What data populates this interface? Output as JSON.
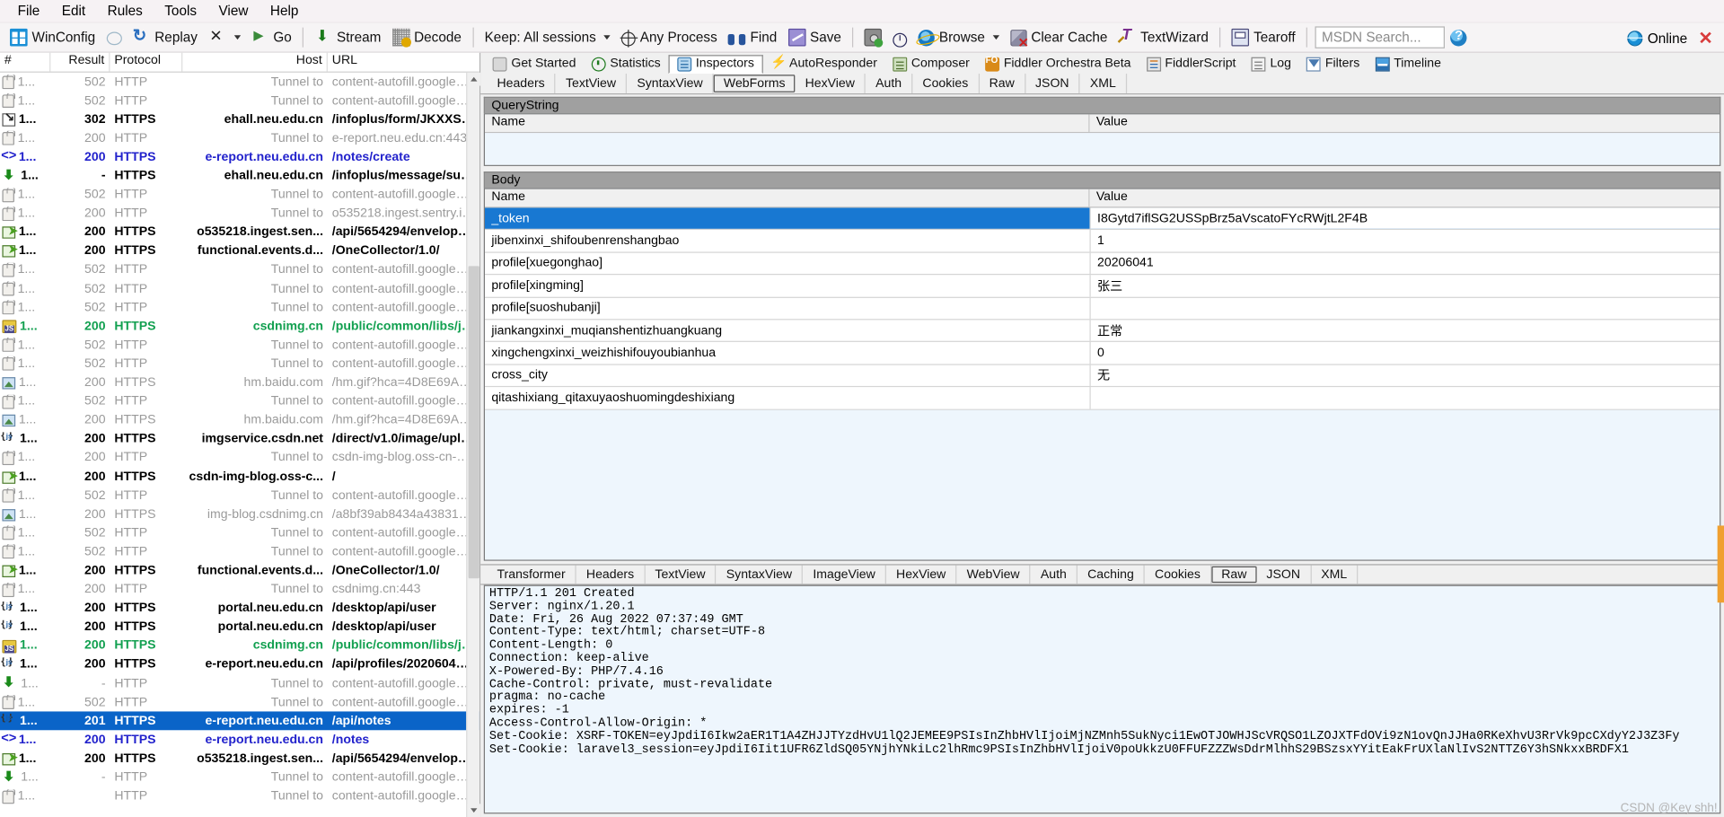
{
  "menu": {
    "items": [
      "File",
      "Edit",
      "Rules",
      "Tools",
      "View",
      "Help"
    ]
  },
  "toolbar": {
    "winconfig": "WinConfig",
    "replay": "Replay",
    "go": "Go",
    "stream": "Stream",
    "decode": "Decode",
    "keep": "Keep: All sessions",
    "any_process": "Any Process",
    "find": "Find",
    "save": "Save",
    "browse": "Browse",
    "clear_cache": "Clear Cache",
    "textwizard": "TextWizard",
    "tearoff": "Tearoff",
    "msdn_search": "MSDN Search...",
    "online": "Online",
    "close": "✕"
  },
  "sessions": {
    "columns": [
      "#",
      "Result",
      "Protocol",
      "Host",
      "URL"
    ],
    "rows": [
      {
        "icon": "lock-icon",
        "num": "1...",
        "result": "502",
        "protocol": "HTTP",
        "host": "Tunnel to",
        "url": "content-autofill.googleapi...",
        "style": "t-grey"
      },
      {
        "icon": "lock-icon",
        "num": "1...",
        "result": "502",
        "protocol": "HTTP",
        "host": "Tunnel to",
        "url": "content-autofill.googleapi...",
        "style": "t-grey"
      },
      {
        "icon": "redirect-icon",
        "num": "1...",
        "result": "302",
        "protocol": "HTTPS",
        "host": "ehall.neu.edu.cn",
        "url": "/infoplus/form/JKXXSB/start",
        "style": "t-black"
      },
      {
        "icon": "lock-icon",
        "num": "1...",
        "result": "200",
        "protocol": "HTTP",
        "host": "Tunnel to",
        "url": "e-report.neu.edu.cn:443",
        "style": "t-grey"
      },
      {
        "icon": "html-doc-icon",
        "num": "1...",
        "result": "200",
        "protocol": "HTTPS",
        "host": "e-report.neu.edu.cn",
        "url": "/notes/create",
        "style": "t-blue"
      },
      {
        "icon": "download-icon",
        "num": "1...",
        "result": "-",
        "protocol": "HTTPS",
        "host": "ehall.neu.edu.cn",
        "url": "/infoplus/message/sub?ui...",
        "style": "t-black"
      },
      {
        "icon": "lock-icon",
        "num": "1...",
        "result": "502",
        "protocol": "HTTP",
        "host": "Tunnel to",
        "url": "content-autofill.googleapi...",
        "style": "t-grey"
      },
      {
        "icon": "lock-icon",
        "num": "1...",
        "result": "200",
        "protocol": "HTTP",
        "host": "Tunnel to",
        "url": "o535218.ingest.sentry.io:...",
        "style": "t-grey"
      },
      {
        "icon": "send-icon",
        "num": "1...",
        "result": "200",
        "protocol": "HTTPS",
        "host": "o535218.ingest.sen...",
        "url": "/api/5654294/envelope/?s...",
        "style": "t-black"
      },
      {
        "icon": "send-icon",
        "num": "1...",
        "result": "200",
        "protocol": "HTTPS",
        "host": "functional.events.d...",
        "url": "/OneCollector/1.0/",
        "style": "t-black"
      },
      {
        "icon": "lock-icon",
        "num": "1...",
        "result": "502",
        "protocol": "HTTP",
        "host": "Tunnel to",
        "url": "content-autofill.googleapi...",
        "style": "t-grey"
      },
      {
        "icon": "lock-icon",
        "num": "1...",
        "result": "502",
        "protocol": "HTTP",
        "host": "Tunnel to",
        "url": "content-autofill.googleapi...",
        "style": "t-grey"
      },
      {
        "icon": "lock-icon",
        "num": "1...",
        "result": "502",
        "protocol": "HTTP",
        "host": "Tunnel to",
        "url": "content-autofill.googleapi...",
        "style": "t-grey"
      },
      {
        "icon": "script-icon",
        "num": "1...",
        "result": "200",
        "protocol": "HTTPS",
        "host": "csdnimg.cn",
        "url": "/public/common/libs/jquer...",
        "style": "t-green"
      },
      {
        "icon": "lock-icon",
        "num": "1...",
        "result": "502",
        "protocol": "HTTP",
        "host": "Tunnel to",
        "url": "content-autofill.googleapi...",
        "style": "t-grey"
      },
      {
        "icon": "lock-icon",
        "num": "1...",
        "result": "502",
        "protocol": "HTTP",
        "host": "Tunnel to",
        "url": "content-autofill.googleapi...",
        "style": "t-grey"
      },
      {
        "icon": "image-icon",
        "num": "1...",
        "result": "200",
        "protocol": "HTTPS",
        "host": "hm.baidu.com",
        "url": "/hm.gif?hca=4D8E69A87...",
        "style": "t-grey"
      },
      {
        "icon": "lock-icon",
        "num": "1...",
        "result": "502",
        "protocol": "HTTP",
        "host": "Tunnel to",
        "url": "content-autofill.googleapi...",
        "style": "t-grey"
      },
      {
        "icon": "image-icon",
        "num": "1...",
        "result": "200",
        "protocol": "HTTPS",
        "host": "hm.baidu.com",
        "url": "/hm.gif?hca=4D8E69A87...",
        "style": "t-grey"
      },
      {
        "icon": "json-icon",
        "num": "1...",
        "result": "200",
        "protocol": "HTTPS",
        "host": "imgservice.csdn.net",
        "url": "/direct/v1.0/image/upload...",
        "style": "t-black"
      },
      {
        "icon": "lock-icon",
        "num": "1...",
        "result": "200",
        "protocol": "HTTP",
        "host": "Tunnel to",
        "url": "csdn-img-blog.oss-cn-beiji...",
        "style": "t-grey"
      },
      {
        "icon": "send-icon",
        "num": "1...",
        "result": "200",
        "protocol": "HTTPS",
        "host": "csdn-img-blog.oss-c...",
        "url": "/",
        "style": "t-black"
      },
      {
        "icon": "lock-icon",
        "num": "1...",
        "result": "502",
        "protocol": "HTTP",
        "host": "Tunnel to",
        "url": "content-autofill.googleapi...",
        "style": "t-grey"
      },
      {
        "icon": "image-icon",
        "num": "1...",
        "result": "200",
        "protocol": "HTTPS",
        "host": "img-blog.csdnimg.cn",
        "url": "/a8bf39ab8434a43831b...",
        "style": "t-grey"
      },
      {
        "icon": "lock-icon",
        "num": "1...",
        "result": "502",
        "protocol": "HTTP",
        "host": "Tunnel to",
        "url": "content-autofill.googleapi...",
        "style": "t-grey"
      },
      {
        "icon": "lock-icon",
        "num": "1...",
        "result": "502",
        "protocol": "HTTP",
        "host": "Tunnel to",
        "url": "content-autofill.googleapi...",
        "style": "t-grey"
      },
      {
        "icon": "send-icon",
        "num": "1...",
        "result": "200",
        "protocol": "HTTPS",
        "host": "functional.events.d...",
        "url": "/OneCollector/1.0/",
        "style": "t-black"
      },
      {
        "icon": "lock-icon",
        "num": "1...",
        "result": "200",
        "protocol": "HTTP",
        "host": "Tunnel to",
        "url": "csdnimg.cn:443",
        "style": "t-grey"
      },
      {
        "icon": "json-icon",
        "num": "1...",
        "result": "200",
        "protocol": "HTTPS",
        "host": "portal.neu.edu.cn",
        "url": "/desktop/api/user",
        "style": "t-black"
      },
      {
        "icon": "json-icon",
        "num": "1...",
        "result": "200",
        "protocol": "HTTPS",
        "host": "portal.neu.edu.cn",
        "url": "/desktop/api/user",
        "style": "t-black"
      },
      {
        "icon": "script-icon",
        "num": "1...",
        "result": "200",
        "protocol": "HTTPS",
        "host": "csdnimg.cn",
        "url": "/public/common/libs/jquer...",
        "style": "t-green"
      },
      {
        "icon": "json-icon",
        "num": "1...",
        "result": "200",
        "protocol": "HTTPS",
        "host": "e-report.neu.edu.cn",
        "url": "/api/profiles/20206041?xi...",
        "style": "t-black"
      },
      {
        "icon": "download-icon",
        "num": "1...",
        "result": "-",
        "protocol": "HTTP",
        "host": "Tunnel to",
        "url": "content-autofill.googleapi...",
        "style": "t-grey"
      },
      {
        "icon": "lock-icon",
        "num": "1...",
        "result": "502",
        "protocol": "HTTP",
        "host": "Tunnel to",
        "url": "content-autofill.googleapi...",
        "style": "t-grey"
      },
      {
        "icon": "json-icon",
        "num": "1...",
        "result": "201",
        "protocol": "HTTPS",
        "host": "e-report.neu.edu.cn",
        "url": "/api/notes",
        "style": "t-black",
        "selected": true
      },
      {
        "icon": "html-doc-icon",
        "num": "1...",
        "result": "200",
        "protocol": "HTTPS",
        "host": "e-report.neu.edu.cn",
        "url": "/notes",
        "style": "t-blue"
      },
      {
        "icon": "send-icon",
        "num": "1...",
        "result": "200",
        "protocol": "HTTPS",
        "host": "o535218.ingest.sen...",
        "url": "/api/5654294/envelope/?s...",
        "style": "t-black"
      },
      {
        "icon": "download-icon",
        "num": "1...",
        "result": "-",
        "protocol": "HTTP",
        "host": "Tunnel to",
        "url": "content-autofill.googleapi...",
        "style": "t-grey"
      },
      {
        "icon": "lock-icon",
        "num": "1...",
        "result": "",
        "protocol": "HTTP",
        "host": "Tunnel to",
        "url": "content-autofill.googleapi...",
        "style": "t-grey"
      }
    ]
  },
  "inspector": {
    "top_tabs": [
      {
        "label": "Get Started",
        "icon": "getstarted-icon",
        "active": false
      },
      {
        "label": "Statistics",
        "icon": "statistics-icon",
        "active": false
      },
      {
        "label": "Inspectors",
        "icon": "inspectors-icon",
        "active": true
      },
      {
        "label": "AutoResponder",
        "icon": "autoresponder-icon",
        "active": false
      },
      {
        "label": "Composer",
        "icon": "composer-icon",
        "active": false
      },
      {
        "label": "Fiddler Orchestra Beta",
        "icon": "orchestra-icon",
        "active": false
      },
      {
        "label": "FiddlerScript",
        "icon": "fiddlerscript-icon",
        "active": false
      },
      {
        "label": "Log",
        "icon": "log-icon",
        "active": false
      },
      {
        "label": "Filters",
        "icon": "filters-icon",
        "active": false
      },
      {
        "label": "Timeline",
        "icon": "timeline-icon",
        "active": false
      }
    ],
    "request_tabs": [
      {
        "label": "Headers",
        "active": false
      },
      {
        "label": "TextView",
        "active": false
      },
      {
        "label": "SyntaxView",
        "active": false
      },
      {
        "label": "WebForms",
        "active": true
      },
      {
        "label": "HexView",
        "active": false
      },
      {
        "label": "Auth",
        "active": false
      },
      {
        "label": "Cookies",
        "active": false
      },
      {
        "label": "Raw",
        "active": false
      },
      {
        "label": "JSON",
        "active": false
      },
      {
        "label": "XML",
        "active": false
      }
    ],
    "querystring": {
      "title": "QueryString",
      "col_name": "Name",
      "col_value": "Value",
      "rows": []
    },
    "body": {
      "title": "Body",
      "col_name": "Name",
      "col_value": "Value",
      "rows": [
        {
          "name": "_token",
          "value": "I8Gytd7iflSG2USSpBrz5aVscatoFYcRWjtL2F4B",
          "selected": true
        },
        {
          "name": "jibenxinxi_shifoubenrenshangbao",
          "value": "1"
        },
        {
          "name": "profile[xuegonghao]",
          "value": "20206041"
        },
        {
          "name": "profile[xingming]",
          "value": "张三"
        },
        {
          "name": "profile[suoshubanji]",
          "value": ""
        },
        {
          "name": "jiankangxinxi_muqianshentizhuangkuang",
          "value": "正常"
        },
        {
          "name": "xingchengxinxi_weizhishifouyoubianhua",
          "value": "0"
        },
        {
          "name": "cross_city",
          "value": "无"
        },
        {
          "name": "qitashixiang_qitaxuyaoshuomingdeshixiang",
          "value": ""
        }
      ]
    },
    "response_tabs": [
      {
        "label": "Transformer",
        "active": false
      },
      {
        "label": "Headers",
        "active": false
      },
      {
        "label": "TextView",
        "active": false
      },
      {
        "label": "SyntaxView",
        "active": false
      },
      {
        "label": "ImageView",
        "active": false
      },
      {
        "label": "HexView",
        "active": false
      },
      {
        "label": "WebView",
        "active": false
      },
      {
        "label": "Auth",
        "active": false
      },
      {
        "label": "Caching",
        "active": false
      },
      {
        "label": "Cookies",
        "active": false
      },
      {
        "label": "Raw",
        "active": true
      },
      {
        "label": "JSON",
        "active": false
      },
      {
        "label": "XML",
        "active": false
      }
    ],
    "response_raw": "HTTP/1.1 201 Created\nServer: nginx/1.20.1\nDate: Fri, 26 Aug 2022 07:37:49 GMT\nContent-Type: text/html; charset=UTF-8\nContent-Length: 0\nConnection: keep-alive\nX-Powered-By: PHP/7.4.16\nCache-Control: private, must-revalidate\npragma: no-cache\nexpires: -1\nAccess-Control-Allow-Origin: *\nSet-Cookie: XSRF-TOKEN=eyJpdiI6Ikw2aER1T1A4ZHJJTYzdHvU1lQ2JEMEE9PSIsInZhbHVlIjoiMjNZMnh5SukNyci1EwOTJOWHJScVRQSO1LZOJXTFdOVi9zN1ovQnJJHa0RKeXhvU3RrVk9pcCXdyY2J3Z3Fy\nSet-Cookie: laravel3_session=eyJpdiI6Iit1UFR6ZldSQ05YNjhYNkiLc2lhRmc9PSIsInZhbHVlIjoiV0poUkkzU0FFUFZZZWsDdrMlhhS29BSzsxYYitEakFrUXlaNlIvS2NTTZ6Y3hSNkxxBRDFX1"
  },
  "watermark": "CSDN @Key shh!"
}
